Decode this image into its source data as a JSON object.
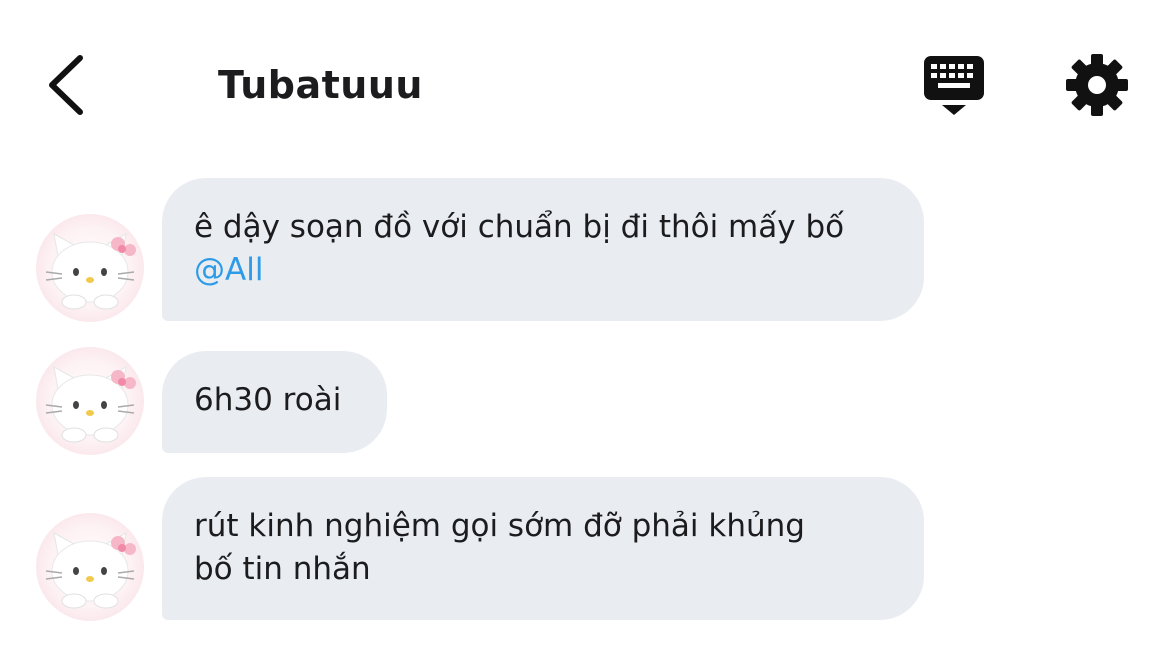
{
  "header": {
    "title": "Tubatuuu",
    "back_icon": "chevron-left-icon",
    "keyboard_icon": "keyboard-hide-icon",
    "settings_icon": "gear-icon"
  },
  "messages": [
    {
      "line1": "ê dậy soạn đồ với chuẩn bị đi thôi mấy bố",
      "mention": "@All",
      "avatar": "hello-kitty-avatar"
    },
    {
      "line1": "6h30 roài",
      "avatar": "hello-kitty-avatar"
    },
    {
      "line1": "rút kinh nghiệm gọi sớm đỡ phải khủng",
      "line2": "bố tin nhắn",
      "avatar": "hello-kitty-avatar"
    }
  ],
  "colors": {
    "bubble_bg": "#e9edf2",
    "mention": "#2d9be6",
    "text": "#1c1c1e"
  }
}
